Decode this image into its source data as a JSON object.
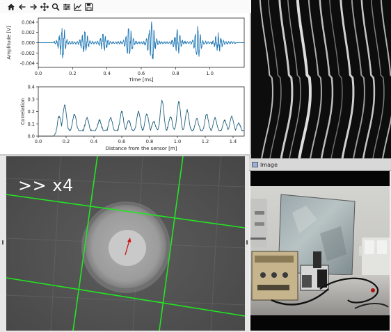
{
  "toolbar": {
    "icons": [
      "home-icon",
      "back-icon",
      "forward-icon",
      "pan-icon",
      "zoom-icon",
      "configure-subplots-icon",
      "edit-axis-icon",
      "save-icon"
    ]
  },
  "chart_data": [
    {
      "type": "line",
      "xlabel": "Time [ms]",
      "ylabel": "Amplitude [V]",
      "xlim": [
        0.0,
        1.2
      ],
      "ylim": [
        -0.0048,
        0.0048
      ],
      "xticks": [
        "0.0",
        "0.2",
        "0.4",
        "0.6",
        "0.8",
        "1.0"
      ],
      "yticks": [
        "0.004",
        "0.002",
        "0.000",
        "-0.002",
        "-0.004"
      ],
      "ytick_values": [
        0.004,
        0.002,
        0.0,
        -0.002,
        -0.004
      ],
      "xtick_values": [
        0.0,
        0.2,
        0.4,
        0.6,
        0.8,
        1.0
      ],
      "color": "#1f77b4",
      "series": [
        {
          "bursts": [
            {
              "t": 0.14,
              "amp": 0.0034
            },
            {
              "t": 0.27,
              "amp": 0.0022
            },
            {
              "t": 0.38,
              "amp": 0.0018
            },
            {
              "t": 0.53,
              "amp": 0.003
            },
            {
              "t": 0.66,
              "amp": 0.0041
            },
            {
              "t": 0.81,
              "amp": 0.0024
            },
            {
              "t": 0.93,
              "amp": 0.0033
            },
            {
              "t": 1.05,
              "amp": 0.002
            }
          ],
          "t_start": 0.09,
          "t_end": 1.15
        }
      ]
    },
    {
      "type": "line",
      "xlabel": "Distance from the sensor [m]",
      "ylabel": "Correlation",
      "xlim": [
        0.0,
        1.48
      ],
      "ylim": [
        0.0,
        0.4
      ],
      "xticks": [
        "0.0",
        "0.2",
        "0.4",
        "0.6",
        "0.8",
        "1.0",
        "1.2",
        "1.4"
      ],
      "xtick_values": [
        0.0,
        0.2,
        0.4,
        0.6,
        0.8,
        1.0,
        1.2,
        1.4
      ],
      "yticks": [
        "0.4",
        "0.3",
        "0.2",
        "0.1",
        "0.0"
      ],
      "ytick_values": [
        0.4,
        0.3,
        0.2,
        0.1,
        0.0
      ],
      "color": "#1f5f7a",
      "peaks": [
        {
          "x": 0.15,
          "y": 0.12
        },
        {
          "x": 0.19,
          "y": 0.21
        },
        {
          "x": 0.26,
          "y": 0.14
        },
        {
          "x": 0.35,
          "y": 0.11
        },
        {
          "x": 0.44,
          "y": 0.09
        },
        {
          "x": 0.52,
          "y": 0.11
        },
        {
          "x": 0.6,
          "y": 0.16
        },
        {
          "x": 0.65,
          "y": 0.09
        },
        {
          "x": 0.72,
          "y": 0.16
        },
        {
          "x": 0.78,
          "y": 0.14
        },
        {
          "x": 0.83,
          "y": 0.08
        },
        {
          "x": 0.89,
          "y": 0.25
        },
        {
          "x": 0.95,
          "y": 0.12
        },
        {
          "x": 1.01,
          "y": 0.24
        },
        {
          "x": 1.07,
          "y": 0.17
        },
        {
          "x": 1.14,
          "y": 0.1
        },
        {
          "x": 1.21,
          "y": 0.14
        },
        {
          "x": 1.27,
          "y": 0.11
        },
        {
          "x": 1.34,
          "y": 0.09
        },
        {
          "x": 1.39,
          "y": 0.12
        },
        {
          "x": 1.44,
          "y": 0.07
        }
      ]
    }
  ],
  "zoom": {
    "label": ">> x4"
  },
  "image_window": {
    "title": "Image"
  }
}
